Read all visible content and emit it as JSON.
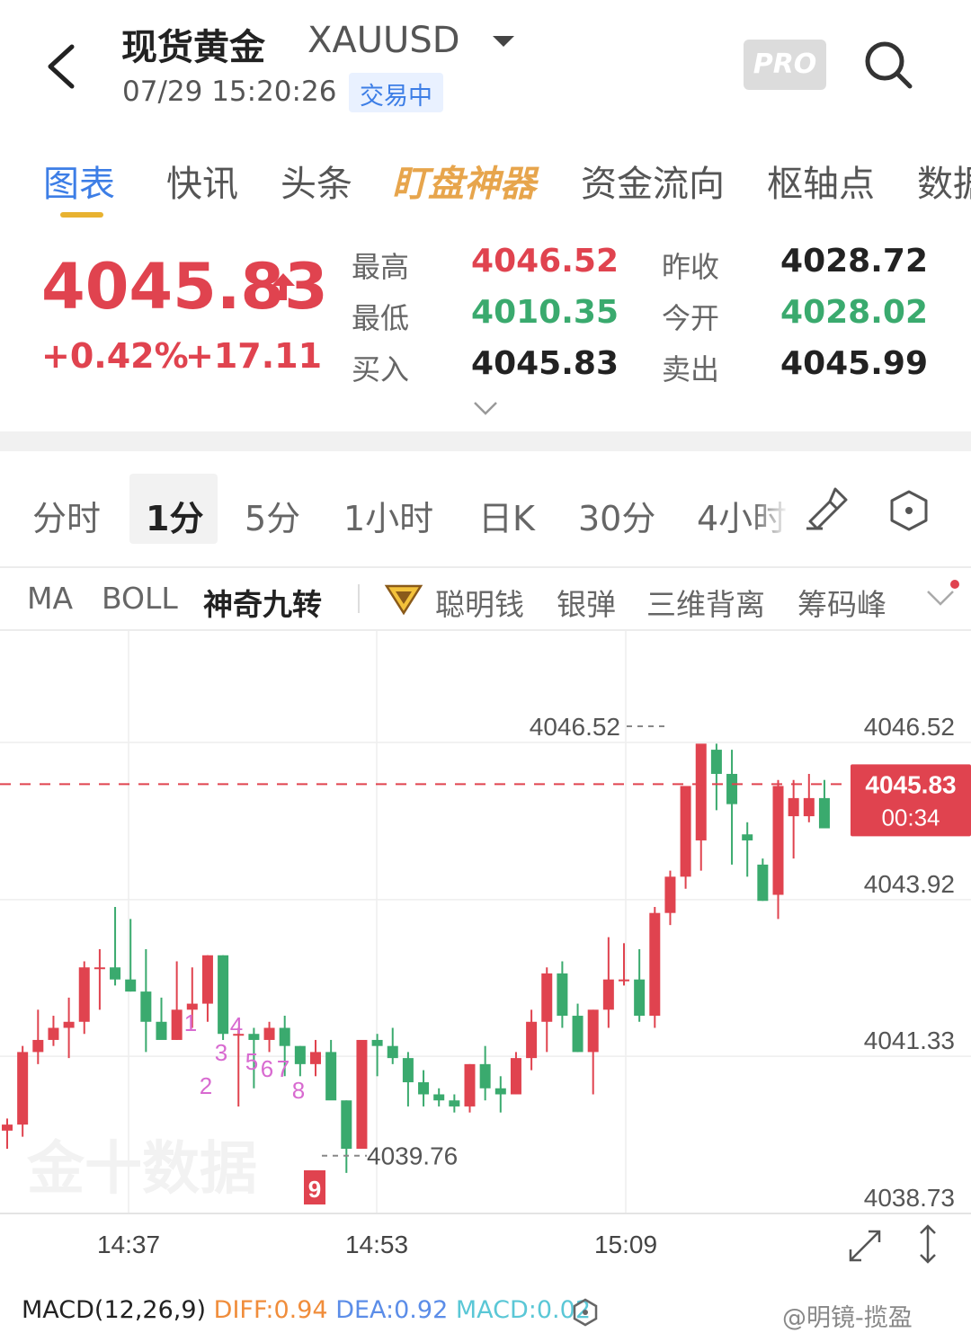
{
  "header": {
    "title": "现货黄金",
    "symbol": "XAUUSD",
    "timestamp": "07/29 15:20:26",
    "status": "交易中",
    "pro": "PRO"
  },
  "tabs": [
    {
      "label": "图表"
    },
    {
      "label": "快讯"
    },
    {
      "label": "头条"
    },
    {
      "label": "盯盘神器"
    },
    {
      "label": "资金流向"
    },
    {
      "label": "枢轴点"
    },
    {
      "label": "数据"
    }
  ],
  "quote": {
    "price": "4045.83",
    "change_pct": "+0.42%",
    "change": "+17.11",
    "high_label": "最高",
    "high": "4046.52",
    "low_label": "最低",
    "low": "4010.35",
    "bid_label": "买入",
    "bid": "4045.83",
    "prev_close_label": "昨收",
    "prev_close": "4028.72",
    "open_label": "今开",
    "open": "4028.02",
    "ask_label": "卖出",
    "ask": "4045.99"
  },
  "periods": [
    {
      "label": "分时"
    },
    {
      "label": "1分"
    },
    {
      "label": "5分"
    },
    {
      "label": "1小时"
    },
    {
      "label": "日K"
    },
    {
      "label": "30分"
    },
    {
      "label": "4小时"
    }
  ],
  "indicators": [
    {
      "label": "MA"
    },
    {
      "label": "BOLL"
    },
    {
      "label": "神奇九转"
    },
    {
      "label": "聪明钱"
    },
    {
      "label": "银弹"
    },
    {
      "label": "三维背离"
    },
    {
      "label": "筹码峰"
    }
  ],
  "chart_data": {
    "type": "candlestick",
    "y_ticks": [
      "4046.52",
      "4043.92",
      "4041.33",
      "4038.73"
    ],
    "x_ticks": [
      "14:37",
      "14:53",
      "15:09"
    ],
    "high_annotation": "4046.52",
    "low_annotation": "4039.76",
    "current_price": "4045.83",
    "countdown": "00:34",
    "td_sequence_labels": [
      "1",
      "2",
      "3",
      "4",
      "5",
      "6",
      "7",
      "8",
      "9"
    ],
    "watermark": "金十数据",
    "ylim": [
      4038.73,
      4046.52
    ],
    "candles": [
      [
        4040.1,
        4040.3,
        4039.8,
        4040.2
      ],
      [
        4040.2,
        4041.5,
        4040.0,
        4041.4
      ],
      [
        4041.4,
        4042.1,
        4041.2,
        4041.6
      ],
      [
        4041.6,
        4042.0,
        4041.5,
        4041.8
      ],
      [
        4041.8,
        4042.3,
        4041.3,
        4041.9
      ],
      [
        4041.9,
        4042.9,
        4041.7,
        4042.8
      ],
      [
        4042.8,
        4043.1,
        4042.1,
        4042.8
      ],
      [
        4042.8,
        4043.8,
        4042.5,
        4042.6
      ],
      [
        4042.6,
        4043.6,
        4042.4,
        4042.4
      ],
      [
        4042.4,
        4043.1,
        4041.4,
        4041.9
      ],
      [
        4041.9,
        4042.3,
        4041.7,
        4041.6
      ],
      [
        4041.6,
        4042.9,
        4041.6,
        4042.1
      ],
      [
        4042.1,
        4042.8,
        4041.8,
        4042.2
      ],
      [
        4042.2,
        4043.0,
        4041.9,
        4043.0
      ],
      [
        4043.0,
        4043.0,
        4041.6,
        4041.7
      ],
      [
        4041.7,
        4041.8,
        4040.5,
        4041.7
      ],
      [
        4041.7,
        4041.8,
        4040.8,
        4041.6
      ],
      [
        4041.6,
        4041.9,
        4041.4,
        4041.8
      ],
      [
        4041.8,
        4042.0,
        4041.0,
        4041.5
      ],
      [
        4041.5,
        4041.5,
        4041.0,
        4041.2
      ],
      [
        4041.2,
        4041.6,
        4041.0,
        4041.4
      ],
      [
        4041.4,
        4041.6,
        4040.7,
        4040.6
      ],
      [
        4040.6,
        4040.6,
        4039.4,
        4039.8
      ],
      [
        4039.8,
        4041.6,
        4039.9,
        4041.6
      ],
      [
        4041.6,
        4041.7,
        4041.0,
        4041.5
      ],
      [
        4041.5,
        4041.8,
        4041.2,
        4041.3
      ],
      [
        4041.3,
        4041.4,
        4040.5,
        4040.9
      ],
      [
        4040.9,
        4041.1,
        4040.5,
        4040.7
      ],
      [
        4040.7,
        4040.8,
        4040.5,
        4040.6
      ],
      [
        4040.6,
        4040.7,
        4040.4,
        4040.5
      ],
      [
        4040.5,
        4041.2,
        4040.4,
        4041.2
      ],
      [
        4041.2,
        4041.5,
        4040.6,
        4040.8
      ],
      [
        4040.8,
        4041.0,
        4040.4,
        4040.7
      ],
      [
        4040.7,
        4041.4,
        4040.7,
        4041.3
      ],
      [
        4041.3,
        4042.1,
        4041.1,
        4041.9
      ],
      [
        4041.9,
        4042.8,
        4041.4,
        4042.7
      ],
      [
        4042.7,
        4042.9,
        4041.8,
        4042.0
      ],
      [
        4042.0,
        4042.2,
        4041.4,
        4041.4
      ],
      [
        4041.4,
        4042.1,
        4040.7,
        4042.1
      ],
      [
        4042.1,
        4043.3,
        4041.8,
        4042.6
      ],
      [
        4042.6,
        4043.2,
        4042.5,
        4042.6
      ],
      [
        4042.6,
        4043.1,
        4041.9,
        4042.0
      ],
      [
        4042.0,
        4043.8,
        4041.8,
        4043.7
      ],
      [
        4043.7,
        4044.4,
        4043.5,
        4044.3
      ],
      [
        4044.3,
        4045.6,
        4044.1,
        4045.8
      ],
      [
        4044.9,
        4046.0,
        4044.4,
        4046.5
      ],
      [
        4046.4,
        4046.5,
        4045.4,
        4046.0
      ],
      [
        4046.0,
        4046.4,
        4044.5,
        4045.5
      ],
      [
        4045.0,
        4045.2,
        4044.3,
        4044.9
      ],
      [
        4044.5,
        4044.6,
        4043.9,
        4043.9
      ],
      [
        4044.0,
        4045.9,
        4043.6,
        4045.8
      ],
      [
        4045.3,
        4045.9,
        4044.6,
        4045.6
      ],
      [
        4045.3,
        4046.0,
        4045.2,
        4045.6
      ],
      [
        4045.6,
        4045.9,
        4045.2,
        4045.1
      ]
    ]
  },
  "macd": {
    "label": "MACD(12,26,9)",
    "diff": "DIFF:0.94",
    "dea": "DEA:0.92",
    "macd": "MACD:0.02",
    "colors": {
      "diff": "#f08d3b",
      "dea": "#5b8de8",
      "macd": "#5ac7d6"
    }
  },
  "footer_watermark": "@明镜-揽盈",
  "colors": {
    "up": "#e0434f",
    "down": "#3aaa6e",
    "accent": "#3d7ee6",
    "gold": "#e7a54c"
  }
}
